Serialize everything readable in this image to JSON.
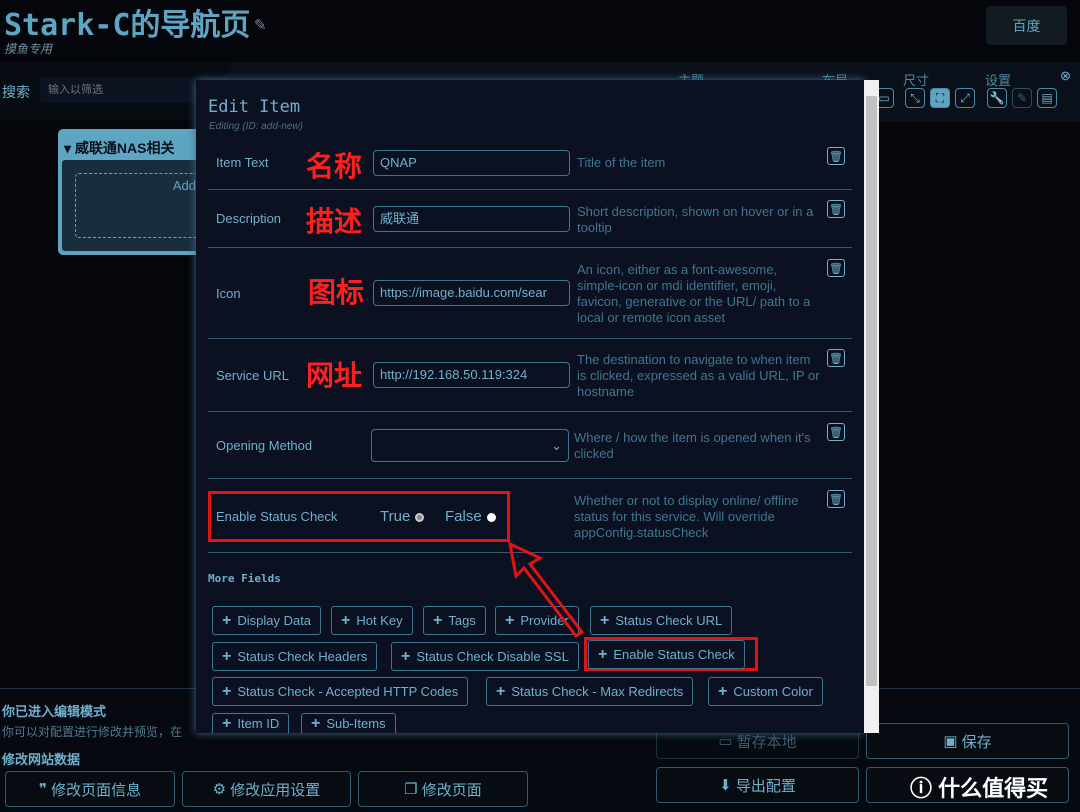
{
  "header": {
    "title": "Stark-C的导航页",
    "subtitle": "摸鱼专用",
    "baidu": "百度"
  },
  "search": {
    "label": "搜索",
    "placeholder": "输入以筛选"
  },
  "settings": {
    "theme": "主题",
    "layout": "布局",
    "size": "尺寸",
    "config": "设置"
  },
  "group": {
    "title": "威联通NAS相关",
    "add": "Add"
  },
  "modal": {
    "title": "Edit Item",
    "subtitle": "Editing (ID: add-new)",
    "fields": [
      {
        "label": "Item Text",
        "annotation": "名称",
        "value": "QNAP",
        "desc": "Title of the item"
      },
      {
        "label": "Description",
        "annotation": "描述",
        "value": "威联通",
        "desc": "Short description, shown on hover or in a tooltip"
      },
      {
        "label": "Icon",
        "annotation": "图标",
        "value": "https://image.baidu.com/sear",
        "desc": "An icon, either as a font-awesome, simple-icon or mdi identifier, emoji, favicon, generative or the URL/ path to a local or remote icon asset"
      },
      {
        "label": "Service URL",
        "annotation": "网址",
        "value": "http://192.168.50.119:324",
        "desc": "The destination to navigate to when item is clicked, expressed as a valid URL, IP or hostname"
      },
      {
        "label": "Opening Method",
        "value": "",
        "desc": "Where / how the item is opened when it's clicked"
      }
    ],
    "status": {
      "label": "Enable Status Check",
      "true": "True",
      "false": "False",
      "selected": "False",
      "desc": "Whether or not to display online/ offline status for this service. Will override appConfig.statusCheck"
    },
    "more_fields": "More Fields",
    "buttons": [
      "Display Data",
      "Hot Key",
      "Tags",
      "Provider",
      "Status Check URL",
      "Status Check Headers",
      "Status Check Disable SSL",
      "Enable Status Check",
      "Status Check - Accepted HTTP Codes",
      "Status Check - Max Redirects",
      "Custom Color",
      "Item ID",
      "Sub-Items"
    ]
  },
  "bottom": {
    "edit_mode": "你已进入编辑模式",
    "edit_desc": "你可以对配置进行修改并预览，在",
    "modify_data": "修改网站数据",
    "btn_page_info": "修改页面信息",
    "btn_app_settings": "修改应用设置",
    "btn_pages": "修改页面",
    "btn_save_local": "暂存本地",
    "btn_save": "保存",
    "btn_export": "导出配置",
    "watermark": "什么值得买"
  },
  "colors": {
    "accent": "#5ea5c2",
    "background": "#04060b",
    "modal": "#0b1120",
    "annotation": "#ff1f1f"
  }
}
